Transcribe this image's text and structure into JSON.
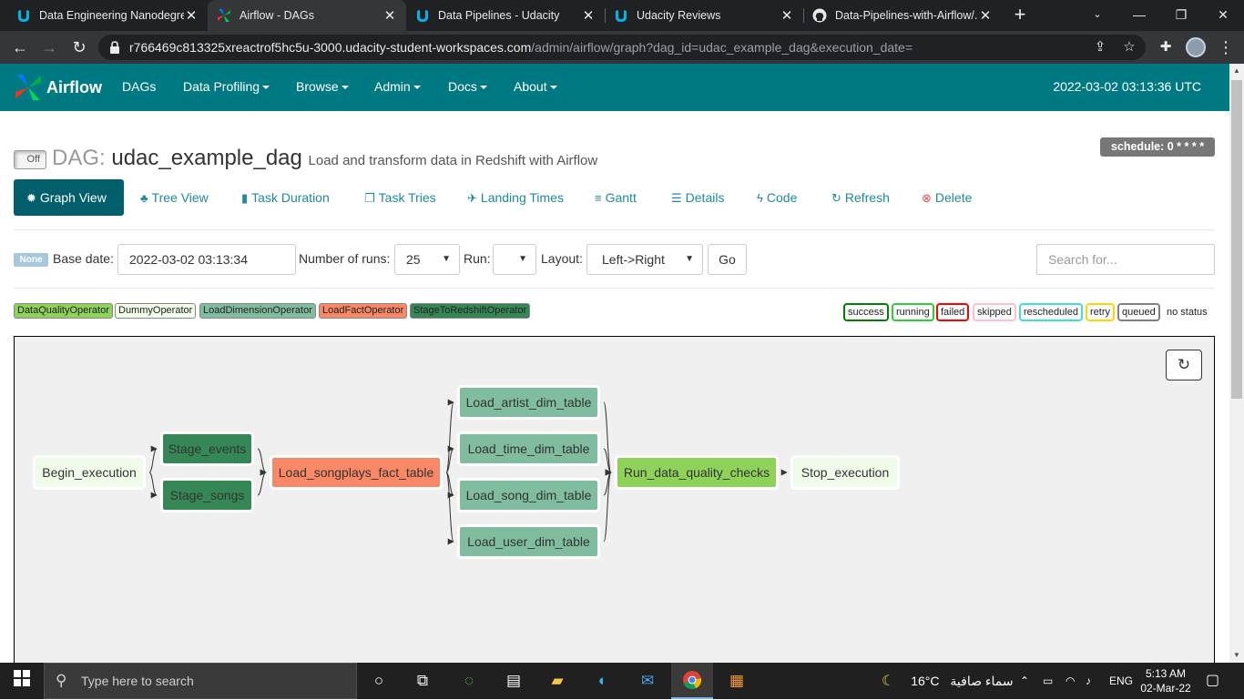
{
  "browser": {
    "tabs": [
      {
        "title": "Data Engineering Nanodegree",
        "icon": "udacity-icon"
      },
      {
        "title": "Airflow - DAGs",
        "icon": "airflow-icon"
      },
      {
        "title": "Data Pipelines - Udacity",
        "icon": "udacity-icon"
      },
      {
        "title": "Udacity Reviews",
        "icon": "udacity-icon"
      },
      {
        "title": "Data-Pipelines-with-Airflow/...",
        "icon": "github-icon"
      }
    ],
    "active_tab_index": 1,
    "url_host": "r766469c813325xreactrof5hc5u-3000.udacity-student-workspaces.com",
    "url_path": "/admin/airflow/graph?dag_id=udac_example_dag&execution_date="
  },
  "nav": {
    "brand": "Airflow",
    "items": [
      "DAGs",
      "Data Profiling",
      "Browse",
      "Admin",
      "Docs",
      "About"
    ],
    "time": "2022-03-02 03:13:36 UTC"
  },
  "dag": {
    "toggle": "Off",
    "label": "DAG:",
    "id": "udac_example_dag",
    "description": "Load and transform data in Redshift with Airflow",
    "schedule": "schedule: 0 * * * *"
  },
  "view_tabs": [
    {
      "label": "Graph View",
      "icon": "sun-icon"
    },
    {
      "label": "Tree View",
      "icon": "tree-icon"
    },
    {
      "label": "Task Duration",
      "icon": "bar-chart-icon"
    },
    {
      "label": "Task Tries",
      "icon": "files-icon"
    },
    {
      "label": "Landing Times",
      "icon": "plane-icon"
    },
    {
      "label": "Gantt",
      "icon": "align-left-icon"
    },
    {
      "label": "Details",
      "icon": "list-icon"
    },
    {
      "label": "Code",
      "icon": "flash-icon"
    },
    {
      "label": "Refresh",
      "icon": "refresh-icon"
    },
    {
      "label": "Delete",
      "icon": "delete-icon"
    }
  ],
  "controls": {
    "state_badge": "None",
    "base_date_label": "Base date:",
    "base_date": "2022-03-02 03:13:34",
    "runs_label": "Number of runs:",
    "runs": "25",
    "run_label": "Run:",
    "run": "",
    "layout_label": "Layout:",
    "layout": "Left->Right",
    "go": "Go",
    "search_placeholder": "Search for..."
  },
  "operator_legend": [
    {
      "label": "DataQualityOperator",
      "color": "#8fd25a"
    },
    {
      "label": "DummyOperator",
      "color": "#f0fce9"
    },
    {
      "label": "LoadDimensionOperator",
      "color": "#80bd9e"
    },
    {
      "label": "LoadFactOperator",
      "color": "#f98866"
    },
    {
      "label": "StageToRedshiftOperator",
      "color": "#358856"
    }
  ],
  "status_legend": [
    {
      "label": "success",
      "color": "#008000"
    },
    {
      "label": "running",
      "color": "#32cd32"
    },
    {
      "label": "failed",
      "color": "#ff0000"
    },
    {
      "label": "skipped",
      "color": "#ffc0cb"
    },
    {
      "label": "rescheduled",
      "color": "#40e0d0"
    },
    {
      "label": "retry",
      "color": "#ffd700"
    },
    {
      "label": "queued",
      "color": "#808080"
    },
    {
      "label": "no status",
      "color": "#ffffff"
    }
  ],
  "graph": {
    "nodes": [
      {
        "id": "Begin_execution",
        "color": "#f0fce9"
      },
      {
        "id": "Stage_events",
        "color": "#358856"
      },
      {
        "id": "Stage_songs",
        "color": "#358856"
      },
      {
        "id": "Load_songplays_fact_table",
        "color": "#f98866"
      },
      {
        "id": "Load_artist_dim_table",
        "color": "#80bd9e"
      },
      {
        "id": "Load_time_dim_table",
        "color": "#80bd9e"
      },
      {
        "id": "Load_song_dim_table",
        "color": "#80bd9e"
      },
      {
        "id": "Load_user_dim_table",
        "color": "#80bd9e"
      },
      {
        "id": "Run_data_quality_checks",
        "color": "#8fd25a"
      },
      {
        "id": "Stop_execution",
        "color": "#f0fce9"
      }
    ],
    "edges": [
      [
        "Begin_execution",
        "Stage_events"
      ],
      [
        "Begin_execution",
        "Stage_songs"
      ],
      [
        "Stage_events",
        "Load_songplays_fact_table"
      ],
      [
        "Stage_songs",
        "Load_songplays_fact_table"
      ],
      [
        "Load_songplays_fact_table",
        "Load_artist_dim_table"
      ],
      [
        "Load_songplays_fact_table",
        "Load_time_dim_table"
      ],
      [
        "Load_songplays_fact_table",
        "Load_song_dim_table"
      ],
      [
        "Load_songplays_fact_table",
        "Load_user_dim_table"
      ],
      [
        "Load_artist_dim_table",
        "Run_data_quality_checks"
      ],
      [
        "Load_time_dim_table",
        "Run_data_quality_checks"
      ],
      [
        "Load_song_dim_table",
        "Run_data_quality_checks"
      ],
      [
        "Load_user_dim_table",
        "Run_data_quality_checks"
      ],
      [
        "Run_data_quality_checks",
        "Stop_execution"
      ]
    ]
  },
  "taskbar": {
    "search_placeholder": "Type here to search",
    "temperature": "16°C",
    "weather_text": "سماء صافية",
    "language": "ENG",
    "time": "5:13 AM",
    "date": "02-Mar-22"
  }
}
